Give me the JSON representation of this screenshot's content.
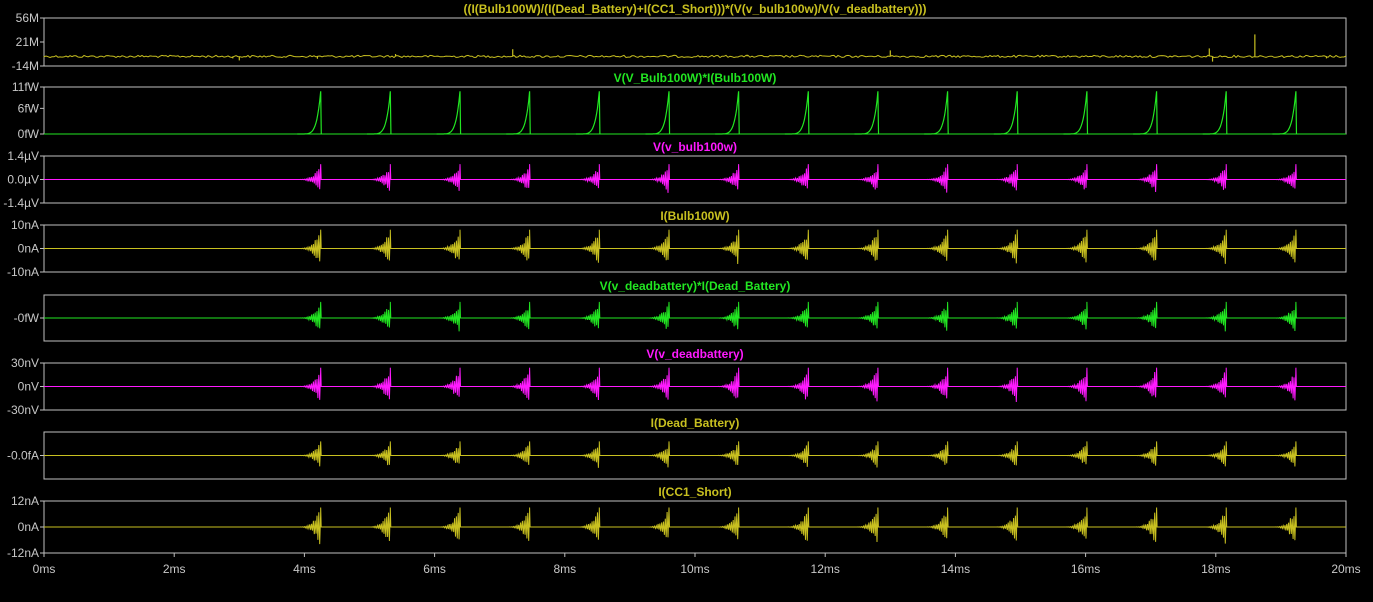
{
  "chart_data": {
    "type": "line",
    "x_unit": "ms",
    "x_range": [
      0,
      20
    ],
    "x_ticks": [
      0,
      2,
      4,
      6,
      8,
      10,
      12,
      14,
      16,
      18,
      20
    ],
    "x_tick_labels": [
      "0ms",
      "2ms",
      "4ms",
      "6ms",
      "8ms",
      "10ms",
      "12ms",
      "14ms",
      "16ms",
      "18ms",
      "20ms"
    ],
    "grid": false,
    "burst_times_ms": [
      4.25,
      5.32,
      6.39,
      7.46,
      8.53,
      9.6,
      10.67,
      11.74,
      12.81,
      13.88,
      14.95,
      16.02,
      17.09,
      18.16,
      19.23
    ],
    "burst_length_ms": 0.36,
    "panes": [
      {
        "title": "((I(Bulb100W)/(I(Dead_Battery)+I(CC1_Short)))*(V(v_bulb100w)/V(v_deadbattery)))",
        "color": "#c8c020",
        "style": "spikes",
        "y_range": [
          -14000000,
          56000000
        ],
        "y_ticks": [
          56000000,
          21000000,
          -14000000
        ],
        "y_tick_labels": [
          "56M",
          "21M",
          "-14M"
        ],
        "spikes": [
          [
            2.9,
            -0.5
          ],
          [
            3.0,
            -1.0
          ],
          [
            4.2,
            -0.6
          ],
          [
            5.4,
            0.6
          ],
          [
            7.2,
            1.8
          ],
          [
            10.8,
            0.4
          ],
          [
            13.0,
            1.5
          ],
          [
            17.9,
            2.0
          ],
          [
            17.95,
            -1.3
          ],
          [
            18.6,
            5.5
          ],
          [
            19.7,
            -0.5
          ]
        ]
      },
      {
        "title": "V(V_Bulb100W)*I(Bulb100W)",
        "color": "#22e622",
        "style": "pulse",
        "y_range": [
          0,
          11
        ],
        "y_ticks": [
          11,
          6,
          0
        ],
        "y_tick_labels": [
          "11fW",
          "6fW",
          "0fW"
        ],
        "peak": 10
      },
      {
        "title": "V(v_bulb100w)",
        "color": "#ff1aff",
        "style": "burst",
        "y_range": [
          -1.4,
          1.4
        ],
        "y_ticks": [
          1.4,
          0.0,
          -1.4
        ],
        "y_tick_labels": [
          "1.4µV",
          "0.0µV",
          "-1.4µV"
        ],
        "peak": 0.92
      },
      {
        "title": "I(Bulb100W)",
        "color": "#c8c020",
        "style": "burst",
        "y_range": [
          -10,
          10
        ],
        "y_ticks": [
          10,
          0,
          -10
        ],
        "y_tick_labels": [
          "10nA",
          "0nA",
          "-10nA"
        ],
        "peak": 8
      },
      {
        "title": "V(v_deadbattery)*I(Dead_Battery)",
        "color": "#22e622",
        "style": "burst",
        "y_range": [
          -1,
          1
        ],
        "y_ticks": [
          0
        ],
        "y_tick_labels": [
          "-0fW"
        ],
        "peak": 0.7
      },
      {
        "title": "V(v_deadbattery)",
        "color": "#ff1aff",
        "style": "burst",
        "y_range": [
          -30,
          30
        ],
        "y_ticks": [
          30,
          0,
          -30
        ],
        "y_tick_labels": [
          "30nV",
          "0nV",
          "-30nV"
        ],
        "peak": 24
      },
      {
        "title": "I(Dead_Battery)",
        "color": "#c8c020",
        "style": "burst",
        "y_range": [
          -1,
          1
        ],
        "y_ticks": [
          0
        ],
        "y_tick_labels": [
          "-0.0fA"
        ],
        "peak": 0.6
      },
      {
        "title": "I(CC1_Short)",
        "color": "#c8c020",
        "style": "burst",
        "y_range": [
          -12,
          12
        ],
        "y_ticks": [
          12,
          0,
          -12
        ],
        "y_tick_labels": [
          "12nA",
          "0nA",
          "-12nA"
        ],
        "peak": 9
      }
    ]
  },
  "colors": {
    "background": "#000000",
    "frame": "#bfbfbf",
    "tick_text": "#c8c8c8"
  }
}
